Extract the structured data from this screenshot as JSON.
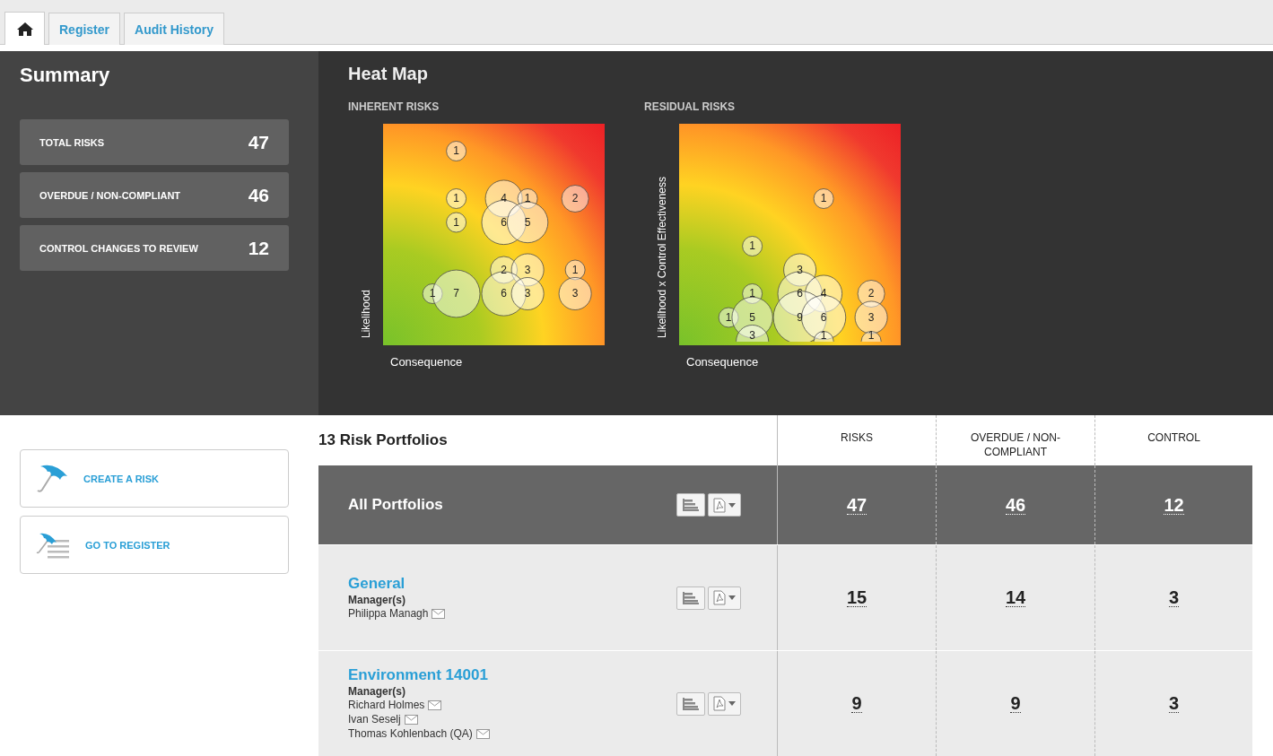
{
  "tabs": [
    {
      "kind": "home",
      "selected": true
    },
    {
      "kind": "text",
      "label": "Register",
      "selected": false
    },
    {
      "kind": "text",
      "label": "Audit History",
      "selected": false
    }
  ],
  "summary": {
    "title": "Summary",
    "stats": [
      {
        "label": "TOTAL RISKS",
        "value": "47"
      },
      {
        "label": "OVERDUE / NON-COMPLIANT",
        "value": "46"
      },
      {
        "label": "CONTROL CHANGES TO REVIEW",
        "value": "12"
      }
    ]
  },
  "heat_map": {
    "title": "Heat Map",
    "maps": [
      {
        "title": "INHERENT RISKS",
        "y_label": "Likelihood",
        "x_label": "Consequence",
        "bubbles": [
          {
            "count": "1"
          },
          {
            "count": "1"
          },
          {
            "count": "4"
          },
          {
            "count": "1"
          },
          {
            "count": "2"
          },
          {
            "count": "1"
          },
          {
            "count": "6"
          },
          {
            "count": "5"
          },
          {
            "count": "2"
          },
          {
            "count": "3"
          },
          {
            "count": "1"
          },
          {
            "count": "1"
          },
          {
            "count": "7"
          },
          {
            "count": "6"
          },
          {
            "count": "3"
          },
          {
            "count": "3"
          }
        ]
      },
      {
        "title": "RESIDUAL RISKS",
        "y_label": "Likelihood x Control Effectiveness",
        "x_label": "Consequence",
        "bubbles": [
          {
            "count": "1"
          },
          {
            "count": "1"
          },
          {
            "count": "3"
          },
          {
            "count": "1"
          },
          {
            "count": "6"
          },
          {
            "count": "4"
          },
          {
            "count": "2"
          },
          {
            "count": "1"
          },
          {
            "count": "5"
          },
          {
            "count": "9"
          },
          {
            "count": "6"
          },
          {
            "count": "3"
          },
          {
            "count": "3"
          },
          {
            "count": "1"
          },
          {
            "count": "1"
          }
        ]
      }
    ]
  },
  "actions": [
    {
      "kind": "create",
      "label": "CREATE A RISK"
    },
    {
      "kind": "register",
      "label": "GO TO REGISTER"
    }
  ],
  "portfolios": {
    "title": "13 Risk Portfolios",
    "columns": [
      "RISKS",
      "OVERDUE / NON-COMPLIANT",
      "CONTROL"
    ],
    "total_row": {
      "name": "All Portfolios",
      "values": [
        "47",
        "46",
        "12"
      ]
    },
    "rows": [
      {
        "name": "General",
        "managers_label": "Manager(s)",
        "managers": [
          "Philippa Managh"
        ],
        "values": [
          "15",
          "14",
          "3"
        ]
      },
      {
        "name": "Environment 14001",
        "managers_label": "Manager(s)",
        "managers": [
          "Richard Holmes",
          "Ivan Seselj",
          "Thomas Kohlenbach (QA)"
        ],
        "values": [
          "9",
          "9",
          "3"
        ]
      }
    ]
  }
}
